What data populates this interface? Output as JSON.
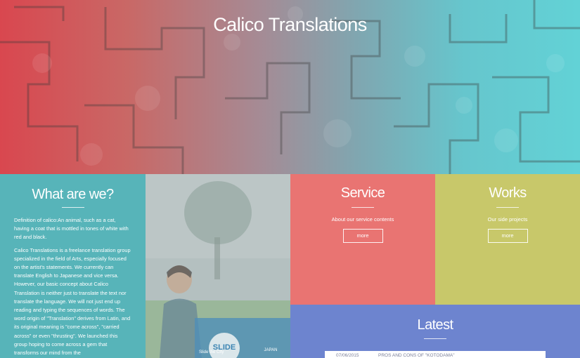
{
  "site": {
    "title": "Calico Translations"
  },
  "what": {
    "title": "What are we?",
    "paragraph1": "Definition of calico:An animal, such as a cat, having a coat that is mottled in tones of white with red and black.",
    "paragraph2": "Calico Translations is a freelance translation group specialized in the field of Arts, especially focused on the artist's statements. We currently can translate English to Japanese and vice versa. However, our basic concept about Calico Translation is neither just to translate the text nor translate the language. We will not just end up reading and typing the sequences of words. The word origin of \"Translation\" derives from Latin, and its original meaning is \"come across\", \"carried across\" or even \"thrusting\". We launched this group hoping to come across a gem that transforms our mind from the"
  },
  "photo": {
    "sign_text": "SLIDE",
    "sign_sub": "Slide the City",
    "sign_right": "JAPAN"
  },
  "service": {
    "title": "Service",
    "subtitle": "About our service contents",
    "button_label": "more"
  },
  "works": {
    "title": "Works",
    "subtitle": "Our side projects",
    "button_label": "more"
  },
  "latest": {
    "title": "Latest",
    "items": [
      {
        "date": "07/06/2015",
        "title": "PROS AND CONS OF \"KOTODAMA\""
      }
    ]
  },
  "colors": {
    "hero_left": "#d9474f",
    "hero_right": "#62d2d6",
    "what_bg": "#57b4b9",
    "service_bg": "#e97472",
    "works_bg": "#c8c86a",
    "latest_bg": "#6d84cf"
  }
}
